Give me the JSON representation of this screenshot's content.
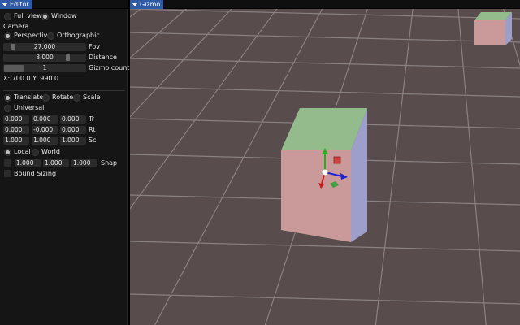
{
  "editor": {
    "title": "Editor",
    "view_mode": {
      "full_view": "Full view",
      "window": "Window",
      "selected": "window"
    },
    "camera_label": "Camera",
    "projection": {
      "perspective": "Perspective",
      "orthographic": "Orthographic",
      "selected": "perspective"
    },
    "fov": {
      "value": "27.000",
      "label": "Fov"
    },
    "distance": {
      "value": "8.000",
      "label": "Distance"
    },
    "gizmo_count": {
      "value": "1",
      "label": "Gizmo count"
    },
    "coords": "X: 700.0 Y: 990.0",
    "operation": {
      "translate": "Translate",
      "rotate": "Rotate",
      "scale": "Scale",
      "universal": "Universal",
      "selected": "translate"
    },
    "tr": {
      "values": [
        "0.000",
        "0.000",
        "0.000"
      ],
      "label": "Tr"
    },
    "rt": {
      "values": [
        "0.000",
        "-0.000",
        "0.000"
      ],
      "label": "Rt"
    },
    "sc": {
      "values": [
        "1.000",
        "1.000",
        "1.000"
      ],
      "label": "Sc"
    },
    "mode": {
      "local": "Local",
      "world": "World",
      "selected": "local"
    },
    "snap": {
      "values": [
        "1.000",
        "1.000",
        "1.000"
      ],
      "label": "Snap",
      "enabled": false
    },
    "bound_sizing": {
      "label": "Bound Sizing",
      "enabled": false
    }
  },
  "gizmo": {
    "title": "Gizmo"
  },
  "colors": {
    "panel_bg": "#151515",
    "tab_active": "#2e5aa6",
    "viewport_bg": "#584c4d",
    "grid_line": "#8a8182",
    "cube_front": "#c99a99",
    "cube_top": "#93bb8c",
    "cube_side": "#9e9ecb",
    "axis_x": "#2020d8",
    "axis_y": "#20b020",
    "axis_z": "#d01818"
  }
}
